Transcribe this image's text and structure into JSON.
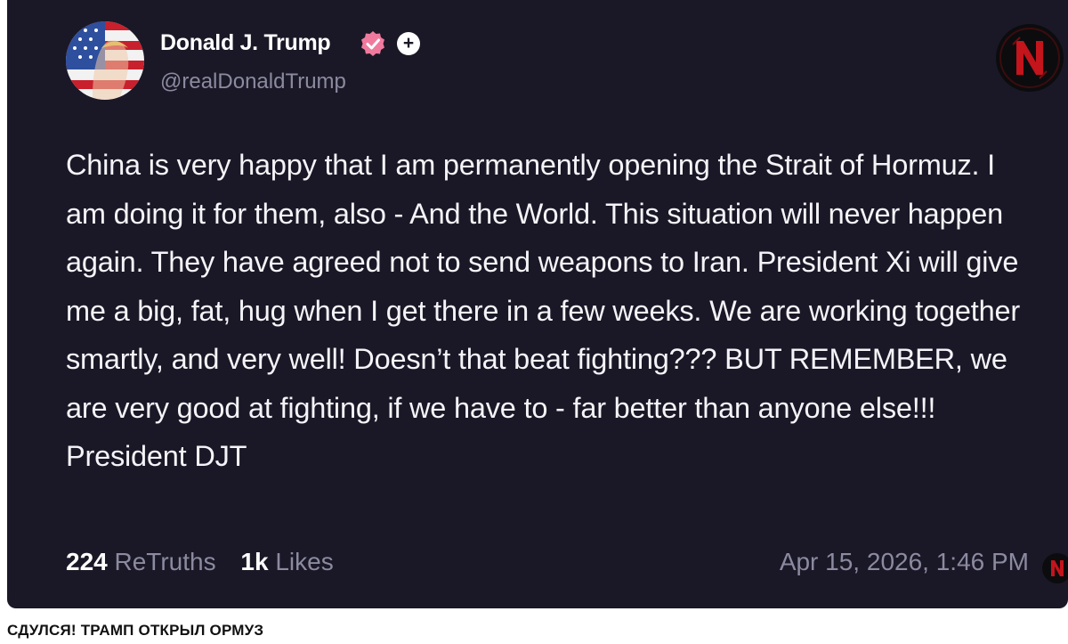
{
  "post": {
    "author_name": "Donald J. Trump",
    "author_handle": "@realDonaldTrump",
    "body": "China is very happy that I am permanently opening the Strait of Hormuz. I am doing it for them, also - And the World. This situation will never happen again. They have agreed not to send weapons to Iran. President Xi will give me a big, fat, hug when I get there in a few weeks. We are working together smartly, and very well! Doesn’t that beat fighting??? BUT REMEMBER, we are very good at fighting, if we have to - far better than anyone else!!! President DJT",
    "retruths_count": "224",
    "retruths_label": "ReTruths",
    "likes_count": "1k",
    "likes_label": "Likes",
    "timestamp": "Apr 15, 2026, 1:46 PM",
    "badge_plus": "+"
  },
  "icons": {
    "verified": "verified-badge-icon",
    "plus": "plus-badge-icon",
    "channel_logo": "channel-logo-n"
  },
  "colors": {
    "card_background": "#1a1826",
    "verified_badge": "#f07a9e",
    "muted_text": "#8b8aa0",
    "logo_red": "#c4141c"
  },
  "caption": {
    "headline": "СДУЛСЯ! ТРАМП ОТКРЫЛ ОРМУЗ"
  }
}
